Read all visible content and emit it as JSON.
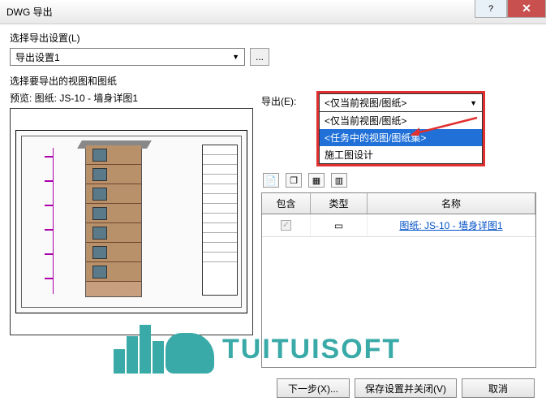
{
  "window": {
    "title": "DWG 导出"
  },
  "settings": {
    "label": "选择导出设置(L)",
    "combo_value": "导出设置1",
    "browse": "..."
  },
  "views_section": {
    "label": "选择要导出的视图和图纸",
    "preview_label": "预览: 图纸: JS-10 - 墙身详图1"
  },
  "export": {
    "label": "导出(E):",
    "selected": "<仅当前视图/图纸>",
    "options": [
      "<仅当前视图/图纸>",
      "<任务中的视图/图纸集>",
      "施工图设计"
    ]
  },
  "toolbar": {
    "i1": "📄",
    "i2": "❐",
    "i3": "▦",
    "i4": "▥"
  },
  "table": {
    "headers": {
      "h1": "包含",
      "h2": "类型",
      "h3": "名称"
    },
    "rows": [
      {
        "type_icon": "▭",
        "name": "图纸: JS-10 - 墙身详图1"
      }
    ]
  },
  "watermark": {
    "text": "TUITUISOFT"
  },
  "footer": {
    "next": "下一步(X)...",
    "save_close": "保存设置并关闭(V)",
    "cancel": "取消"
  }
}
